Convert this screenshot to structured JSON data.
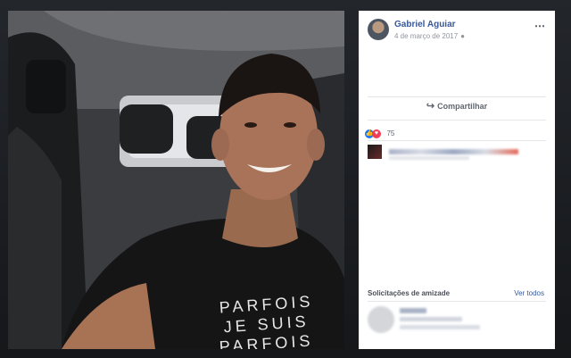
{
  "post": {
    "author": "Gabriel Aguiar",
    "timestamp": "4 de março de 2017",
    "more_icon": "⋯",
    "share_label": "Compartilhar",
    "reaction_count": "75"
  },
  "friend_requests": {
    "title": "Solicitações de amizade",
    "see_all": "Ver todos"
  },
  "shirt": {
    "line1": "PARFOIS",
    "line2": "JE SUIS",
    "line3": "PARFOIS"
  },
  "colors": {
    "link": "#385898",
    "like": "#1877f2",
    "love": "#f33e58"
  }
}
